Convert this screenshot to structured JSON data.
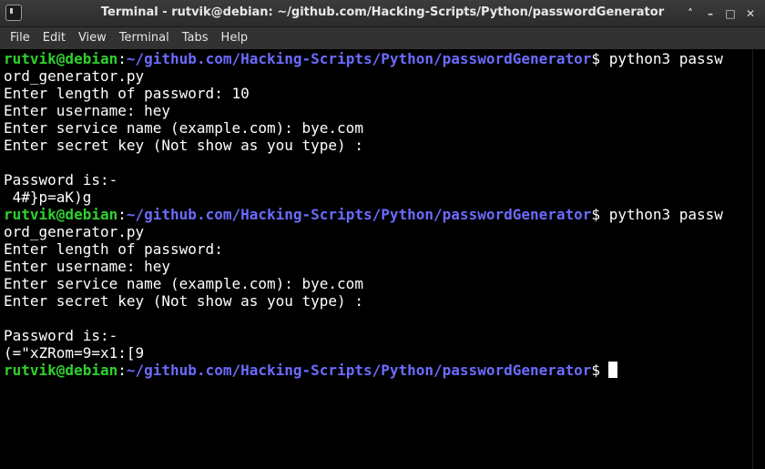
{
  "window": {
    "title": "Terminal - rutvik@debian: ~/github.com/Hacking-Scripts/Python/passwordGenerator",
    "controls": [
      "˄",
      "–",
      "□",
      "✕"
    ]
  },
  "menu": {
    "items": [
      "File",
      "Edit",
      "View",
      "Terminal",
      "Tabs",
      "Help"
    ]
  },
  "terminal": {
    "prompt_user": "rutvik@debian",
    "prompt_sep": ":",
    "prompt_path": "~/github.com/Hacking-Scripts/Python/passwordGenerator",
    "prompt_symbol": "$",
    "lines": [
      " python3 passw",
      "ord_generator.py",
      "Enter length of password: 10",
      "Enter username: hey",
      "Enter service name (example.com): bye.com",
      "Enter secret key (Not show as you type) :",
      "",
      "Password is:-",
      " 4#}p=aK)g",
      " python3 passw",
      "ord_generator.py",
      "Enter length of password:",
      "Enter username: hey",
      "Enter service name (example.com): bye.com",
      "Enter secret key (Not show as you type) :",
      "",
      "Password is:-",
      "(=\"xZRom=9=x1:[9"
    ]
  },
  "colors": {
    "user": "#2fd12f",
    "path": "#6b6bff",
    "text": "#ffffff",
    "background": "#000000"
  }
}
